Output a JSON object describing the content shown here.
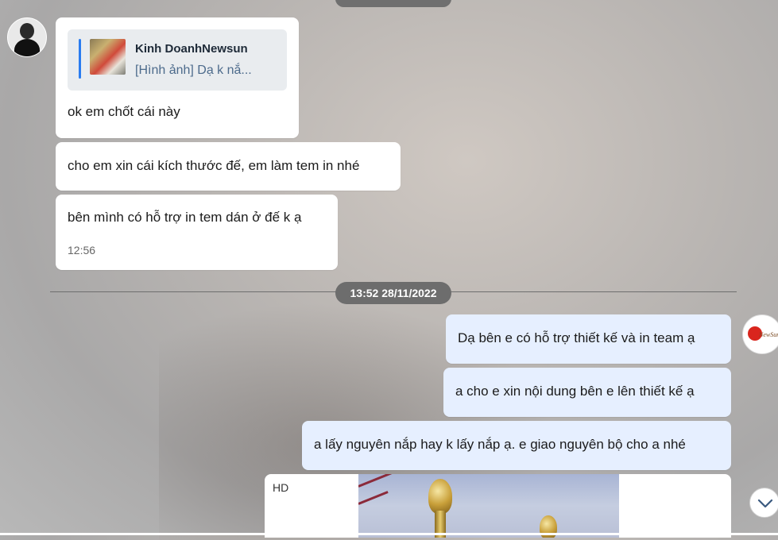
{
  "conversation": {
    "quote": {
      "sender": "Kinh DoanhNewsun",
      "preview": "[Hình ảnh] Dạ k nắ..."
    },
    "incoming": [
      {
        "text": "ok em chốt cái này"
      },
      {
        "text": "cho em xin cái kích thước đế, em làm tem in nhé"
      },
      {
        "text": "bên mình có hỗ trợ in tem dán ở đế k ạ",
        "time": "12:56"
      }
    ],
    "date_separator": "13:52 28/11/2022",
    "outgoing": [
      {
        "text": "Dạ bên e có hỗ trợ thiết kế và in team ạ"
      },
      {
        "text": "a cho e xin nội dung bên e lên thiết kế ạ"
      },
      {
        "text": "a lấy nguyên nắp hay k lấy nắp ạ. e giao nguyên bộ cho a nhé"
      }
    ],
    "image_message": {
      "quality_label": "HD"
    }
  },
  "icons": {
    "scroll_down": "chevron-down-icon",
    "contact_avatar": "avatar",
    "self_avatar": "newsun-logo-avatar"
  },
  "colors": {
    "outgoing_bubble": "#e6efff",
    "incoming_bubble": "#ffffff",
    "quote_bar": "#2a7cf0"
  },
  "self_avatar_text": "NewSun"
}
